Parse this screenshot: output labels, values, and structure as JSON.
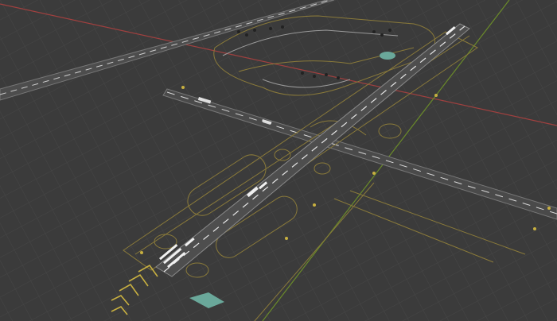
{
  "viewport": {
    "view_mode": "perspective",
    "background_color": "#3b3b3b",
    "grid_minor_color": "#454545",
    "grid_major_color": "#4a4a4a",
    "x_axis_color": "#a0403f",
    "y_axis_color": "#6a8a2a"
  },
  "scene": {
    "objects": [
      {
        "name": "main-runway",
        "type": "runway",
        "color": "#5a5a5a"
      },
      {
        "name": "cross-runway",
        "type": "runway",
        "color": "#5a5a5a"
      },
      {
        "name": "far-runway",
        "type": "runway",
        "color": "#5a5a5a"
      },
      {
        "name": "taxiway-loops",
        "type": "taxiway",
        "color": "#8a7a3a"
      },
      {
        "name": "terminal-apron",
        "type": "apron",
        "color": "#8a7a3a"
      },
      {
        "name": "threshold-chevrons",
        "type": "marking",
        "color": "#c8b040"
      },
      {
        "name": "teal-pad-near",
        "type": "pad",
        "color": "#6aa89a"
      },
      {
        "name": "teal-pad-far",
        "type": "pad",
        "color": "#6aa89a"
      }
    ]
  }
}
